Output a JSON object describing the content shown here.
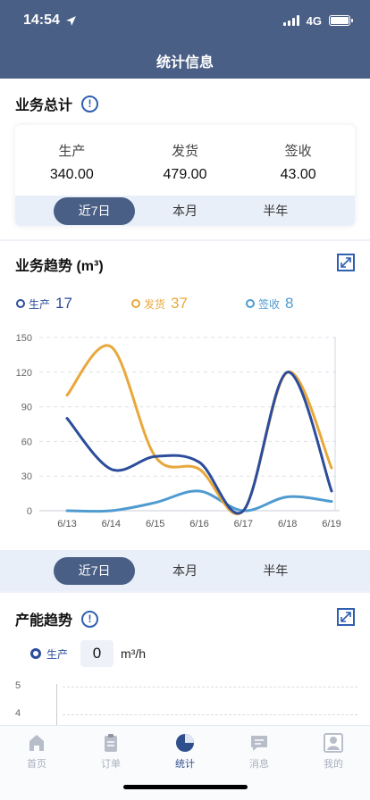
{
  "status": {
    "time": "14:54",
    "network": "4G"
  },
  "header": {
    "title": "统计信息"
  },
  "summary": {
    "title": "业务总计",
    "stats": [
      {
        "label": "生产",
        "value": "340.00"
      },
      {
        "label": "发货",
        "value": "479.00"
      },
      {
        "label": "签收",
        "value": "43.00"
      }
    ],
    "periods": [
      "近7日",
      "本月",
      "半年"
    ],
    "active_period": "近7日"
  },
  "trend": {
    "title": "业务趋势 (m³)",
    "legend": [
      {
        "name": "生产",
        "total": "17",
        "color": "#2c4c9c"
      },
      {
        "name": "发货",
        "total": "37",
        "color": "#e8a83b"
      },
      {
        "name": "签收",
        "total": "8",
        "color": "#4f9bd0"
      }
    ],
    "periods": [
      "近7日",
      "本月",
      "半年"
    ]
  },
  "chart_data": {
    "type": "line",
    "x": [
      "6/13",
      "6/14",
      "6/15",
      "6/16",
      "6/17",
      "6/18",
      "6/19"
    ],
    "yticks": [
      0,
      30,
      60,
      90,
      120,
      150
    ],
    "ylim": [
      0,
      150
    ],
    "grid": true,
    "series": [
      {
        "name": "生产",
        "values": [
          80,
          36,
          47,
          42,
          0,
          120,
          17
        ],
        "color": "#2c4c9c"
      },
      {
        "name": "发货",
        "values": [
          100,
          142,
          47,
          36,
          0,
          120,
          37
        ],
        "color": "#e8a83b"
      },
      {
        "name": "签收",
        "values": [
          0,
          0,
          7,
          17,
          0,
          12,
          8
        ],
        "color": "#4f9bd0"
      }
    ]
  },
  "capacity": {
    "title": "产能趋势",
    "series_label": "生产",
    "value": "0",
    "unit": "m³/h",
    "yticks": [
      "5",
      "4"
    ]
  },
  "tabbar": [
    {
      "label": "首页",
      "icon": "home-icon"
    },
    {
      "label": "订单",
      "icon": "clipboard-icon"
    },
    {
      "label": "统计",
      "icon": "pie-chart-icon"
    },
    {
      "label": "消息",
      "icon": "message-icon"
    },
    {
      "label": "我的",
      "icon": "user-icon"
    }
  ],
  "colors": {
    "header": "#4a5f86",
    "accent": "#2f5fb0"
  }
}
